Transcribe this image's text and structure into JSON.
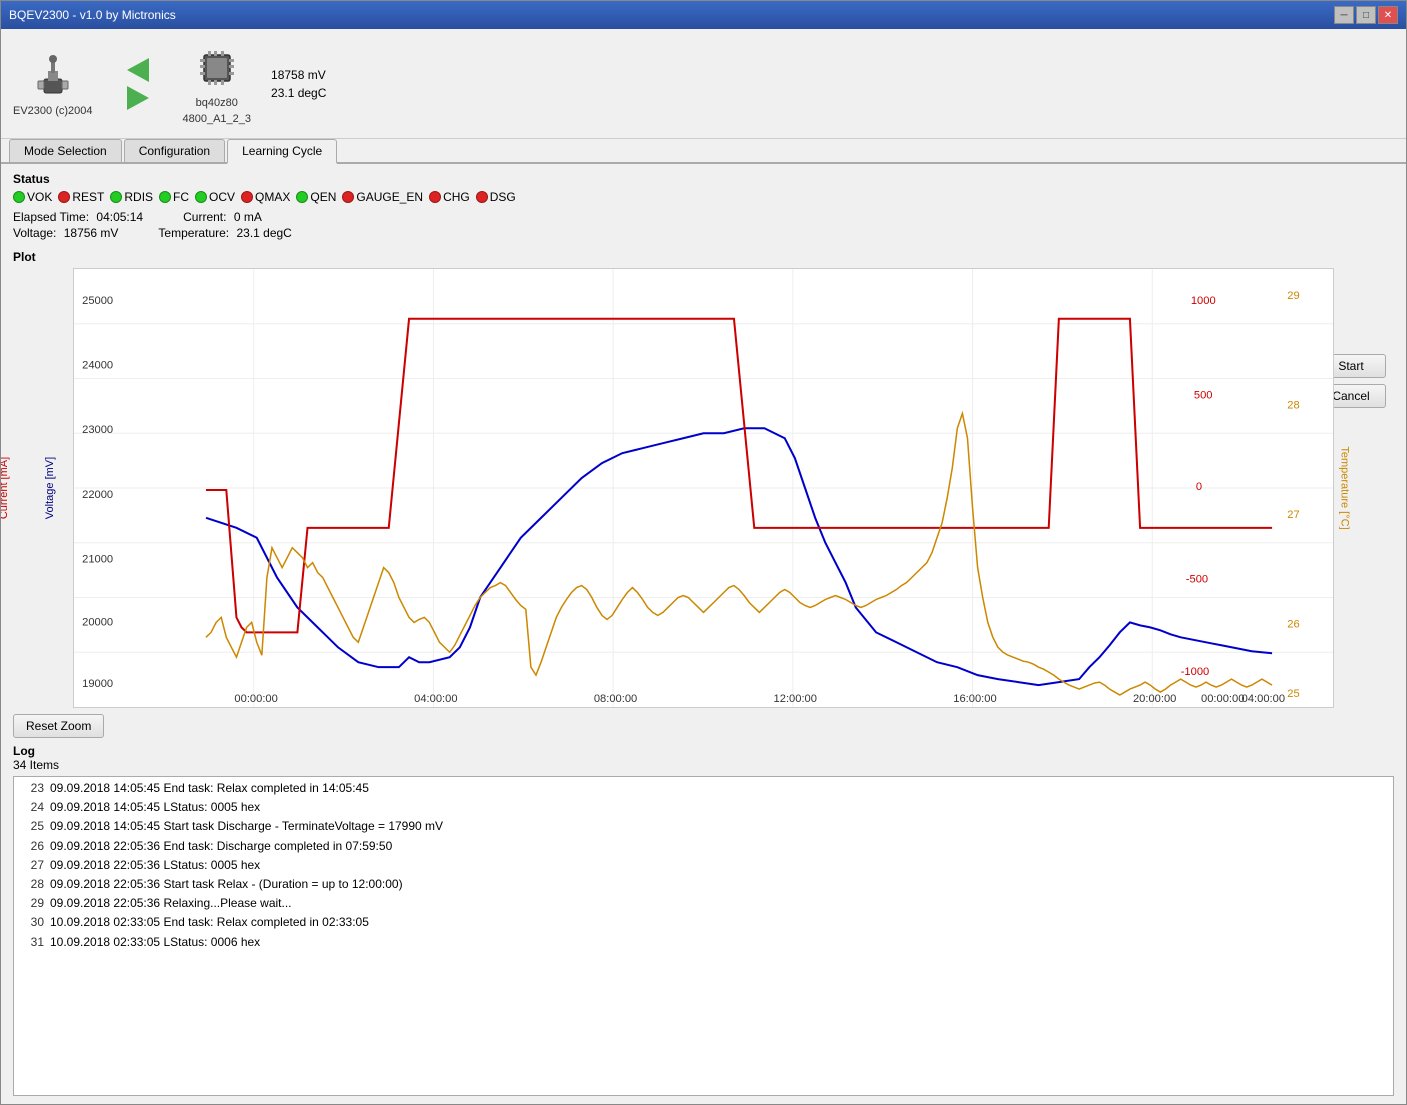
{
  "window": {
    "title": "BQEV2300 - v1.0 by Mictronics",
    "controls": [
      "minimize",
      "maximize",
      "close"
    ]
  },
  "toolbar": {
    "device1_label": "EV2300 (c)2004",
    "device2_label": "bq40z80",
    "device3_label": "4800_A1_2_3",
    "voltage": "18758 mV",
    "temperature": "23.1 degC"
  },
  "tabs": [
    {
      "label": "Mode Selection",
      "active": false
    },
    {
      "label": "Configuration",
      "active": false
    },
    {
      "label": "Learning Cycle",
      "active": true
    }
  ],
  "status": {
    "title": "Status",
    "indicators": [
      {
        "label": "VOK",
        "color": "green"
      },
      {
        "label": "REST",
        "color": "red"
      },
      {
        "label": "RDIS",
        "color": "green"
      },
      {
        "label": "FC",
        "color": "green"
      },
      {
        "label": "OCV",
        "color": "green"
      },
      {
        "label": "QMAX",
        "color": "red"
      },
      {
        "label": "QEN",
        "color": "green"
      },
      {
        "label": "GAUGE_EN",
        "color": "red"
      },
      {
        "label": "CHG",
        "color": "red"
      },
      {
        "label": "DSG",
        "color": "red"
      }
    ],
    "elapsed_label": "Elapsed Time:",
    "elapsed_value": "04:05:14",
    "current_label": "Current:",
    "current_value": "0 mA",
    "voltage_label": "Voltage:",
    "voltage_value": "18756 mV",
    "temperature_label": "Temperature:",
    "temperature_value": "23.1 degC"
  },
  "buttons": {
    "start_label": "Start",
    "cancel_label": "Cancel"
  },
  "plot": {
    "title": "Plot",
    "y_left_label": "Voltage [mV]",
    "y_mid_label": "Current [mA]",
    "y_right_label": "Temperature [°C]"
  },
  "reset_zoom": {
    "label": "Reset Zoom"
  },
  "log": {
    "title": "Log",
    "count": "34 Items",
    "entries": [
      {
        "num": "23",
        "text": "09.09.2018 14:05:45 End task: Relax completed in 14:05:45"
      },
      {
        "num": "24",
        "text": "09.09.2018 14:05:45 LStatus: 0005 hex"
      },
      {
        "num": "25",
        "text": "09.09.2018 14:05:45 Start task Discharge - TerminateVoltage = 17990 mV"
      },
      {
        "num": "26",
        "text": "09.09.2018 22:05:36 End task: Discharge completed in 07:59:50"
      },
      {
        "num": "27",
        "text": "09.09.2018 22:05:36 LStatus: 0005 hex"
      },
      {
        "num": "28",
        "text": "09.09.2018 22:05:36 Start task Relax - (Duration = up to 12:00:00)"
      },
      {
        "num": "29",
        "text": "09.09.2018 22:05:36 Relaxing...Please wait..."
      },
      {
        "num": "30",
        "text": "10.09.2018 02:33:05 End task: Relax completed in 02:33:05"
      },
      {
        "num": "31",
        "text": "10.09.2018 02:33:05 LStatus: 0006 hex"
      }
    ]
  }
}
